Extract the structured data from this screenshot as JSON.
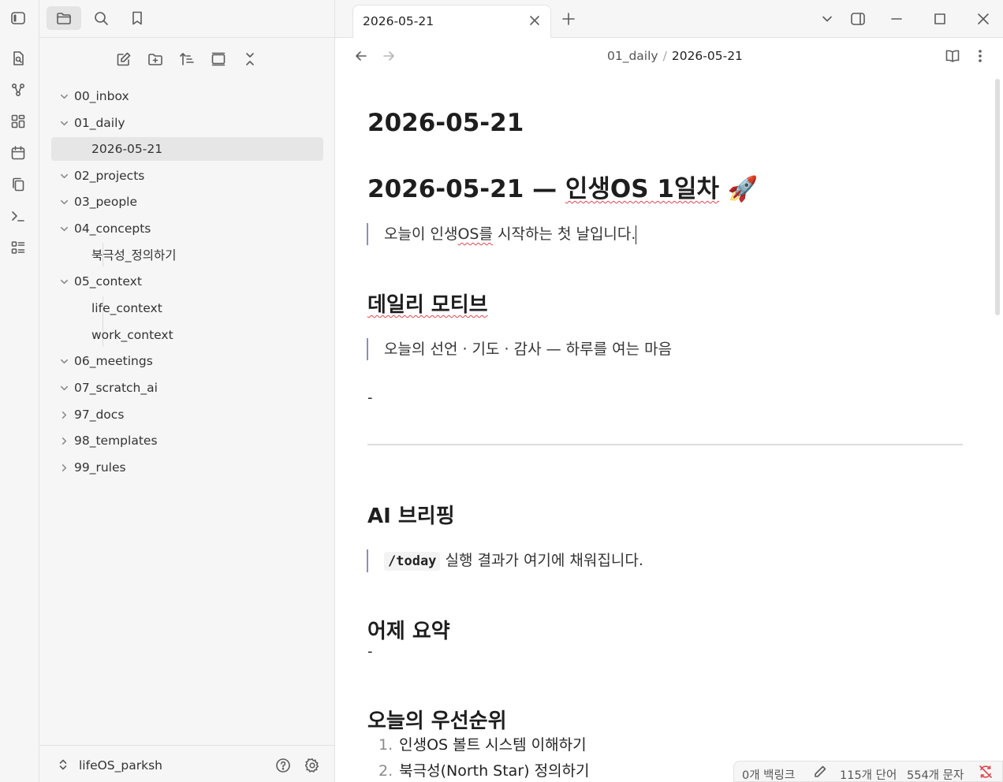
{
  "ribbon": {
    "icons": [
      "sidebar-toggle-icon",
      "file-search-icon",
      "graph-icon",
      "canvas-icon",
      "calendar-icon",
      "copy-files-icon",
      "terminal-icon",
      "list-layout-icon"
    ]
  },
  "sidebar": {
    "top_icons": [
      "folder-icon",
      "search-icon",
      "bookmark-icon"
    ],
    "actions": [
      "new-note-icon",
      "new-folder-icon",
      "sort-icon",
      "layout-icon",
      "collapse-all-icon"
    ],
    "tree": [
      {
        "label": "00_inbox",
        "expanded": true
      },
      {
        "label": "01_daily",
        "expanded": true
      },
      {
        "label": "2026-05-21",
        "child": true,
        "selected": true
      },
      {
        "label": "02_projects",
        "expanded": true
      },
      {
        "label": "03_people",
        "expanded": true
      },
      {
        "label": "04_concepts",
        "expanded": true
      },
      {
        "label": "북극성_정의하기",
        "child": true
      },
      {
        "label": "05_context",
        "expanded": true
      },
      {
        "label": "life_context",
        "child": true
      },
      {
        "label": "work_context",
        "child": true
      },
      {
        "label": "06_meetings",
        "expanded": true
      },
      {
        "label": "07_scratch_ai",
        "expanded": true
      },
      {
        "label": "97_docs",
        "expanded": false
      },
      {
        "label": "98_templates",
        "expanded": false
      },
      {
        "label": "99_rules",
        "expanded": false
      }
    ],
    "vault_name": "lifeOS_parksh"
  },
  "tabs": {
    "active_label": "2026-05-21"
  },
  "view_header": {
    "breadcrumb_parent": "01_daily",
    "breadcrumb_separator": "/",
    "breadcrumb_current": "2026-05-21"
  },
  "editor": {
    "title": "2026-05-21",
    "h1_prefix": "2026-05-21 — ",
    "h1_squiggly": "인생OS 1일차",
    "h1_emoji": "🚀",
    "intro_pre": "오늘이 인생",
    "intro_squiggly": "OS를",
    "intro_post": " 시작하는 첫 날입니다.",
    "motive_heading": "데일리 모티브",
    "motive_quote": "오늘의 선언 · 기도 · 감사 — 하루를 여는 마음",
    "dash": "-",
    "ai_heading": "AI 브리핑",
    "ai_code": "/today",
    "ai_text": " 실행 결과가 여기에 채워집니다.",
    "yesterday_heading": "어제 요약",
    "priority_heading": "오늘의 우선순위",
    "priorities": [
      {
        "num": "1.",
        "text": "인생OS 볼트 시스템 이해하기"
      },
      {
        "num": "2.",
        "text": "북극성(North Star) 정의하기"
      }
    ]
  },
  "status_bar": {
    "backlinks": "0개 백링크",
    "words": "115개 단어",
    "chars": "554개 문자"
  }
}
